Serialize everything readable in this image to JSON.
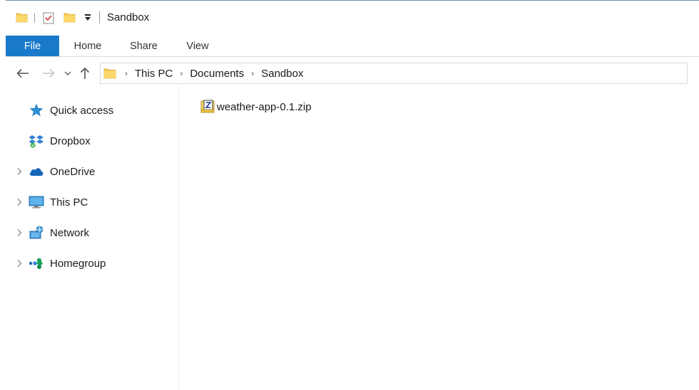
{
  "window": {
    "title": "Sandbox"
  },
  "ribbon": {
    "tabs": [
      {
        "label": "File"
      },
      {
        "label": "Home"
      },
      {
        "label": "Share"
      },
      {
        "label": "View"
      }
    ]
  },
  "address": {
    "crumbs": [
      "This PC",
      "Documents",
      "Sandbox"
    ]
  },
  "nav_pane": {
    "items": [
      {
        "label": "Quick access",
        "icon": "star-icon",
        "expandable": false
      },
      {
        "label": "Dropbox",
        "icon": "dropbox-icon",
        "expandable": false
      },
      {
        "label": "OneDrive",
        "icon": "cloud-icon",
        "expandable": true
      },
      {
        "label": "This PC",
        "icon": "computer-icon",
        "expandable": true
      },
      {
        "label": "Network",
        "icon": "network-icon",
        "expandable": true
      },
      {
        "label": "Homegroup",
        "icon": "homegroup-icon",
        "expandable": true
      }
    ]
  },
  "files": [
    {
      "name": "weather-app-0.1.zip",
      "icon": "zip-archive-icon"
    }
  ],
  "colors": {
    "file_tab": "#1979ca",
    "folder_yellow": "#f6c94b",
    "text": "#1a1a1a"
  }
}
